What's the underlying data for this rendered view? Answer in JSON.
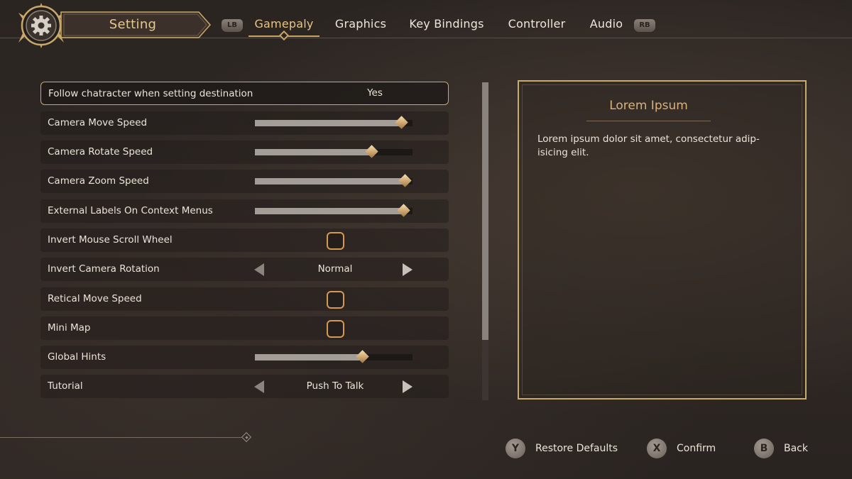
{
  "header": {
    "title": "Setting",
    "left_bumper": "LB",
    "right_bumper": "RB",
    "tabs": [
      {
        "label": "Gamepaly",
        "active": true
      },
      {
        "label": "Graphics",
        "active": false
      },
      {
        "label": "Key Bindings",
        "active": false
      },
      {
        "label": "Controller",
        "active": false
      },
      {
        "label": "Audio",
        "active": false
      }
    ]
  },
  "settings": [
    {
      "label": "Follow chatracter when setting destination",
      "type": "value",
      "value": "Yes",
      "selected": true
    },
    {
      "label": "Camera Move Speed",
      "type": "slider",
      "level": 0.93
    },
    {
      "label": "Camera Rotate Speed",
      "type": "slider",
      "level": 0.74
    },
    {
      "label": "Camera Zoom Speed",
      "type": "slider",
      "level": 0.95
    },
    {
      "label": "External Labels On Context Menus",
      "type": "slider",
      "level": 0.94
    },
    {
      "label": "Invert Mouse Scroll Wheel",
      "type": "checkbox",
      "checked": false
    },
    {
      "label": "Invert Camera Rotation",
      "type": "select",
      "value": "Normal"
    },
    {
      "label": "Retical Move Speed",
      "type": "checkbox",
      "checked": false
    },
    {
      "label": "Mini Map",
      "type": "checkbox",
      "checked": false
    },
    {
      "label": "Global Hints",
      "type": "slider",
      "level": 0.68
    },
    {
      "label": "Tutorial",
      "type": "select",
      "value": "Push To Talk"
    }
  ],
  "scrollbar": {
    "position_fraction": 0.0,
    "visible_fraction": 0.81
  },
  "info_panel": {
    "title": "Lorem Ipsum",
    "body": "Lorem ipsum dolor sit amet, consectetur adip-\nisicing elit."
  },
  "footer": {
    "prompts": [
      {
        "button": "Y",
        "label": "Restore Defaults"
      },
      {
        "button": "X",
        "label": "Confirm"
      },
      {
        "button": "B",
        "label": "Back"
      }
    ]
  },
  "colors": {
    "accent_gold": "#c9a96a",
    "tab_active": "#e8c486",
    "checkbox_border": "#d49a52",
    "slider_fill": "#a39d97"
  }
}
